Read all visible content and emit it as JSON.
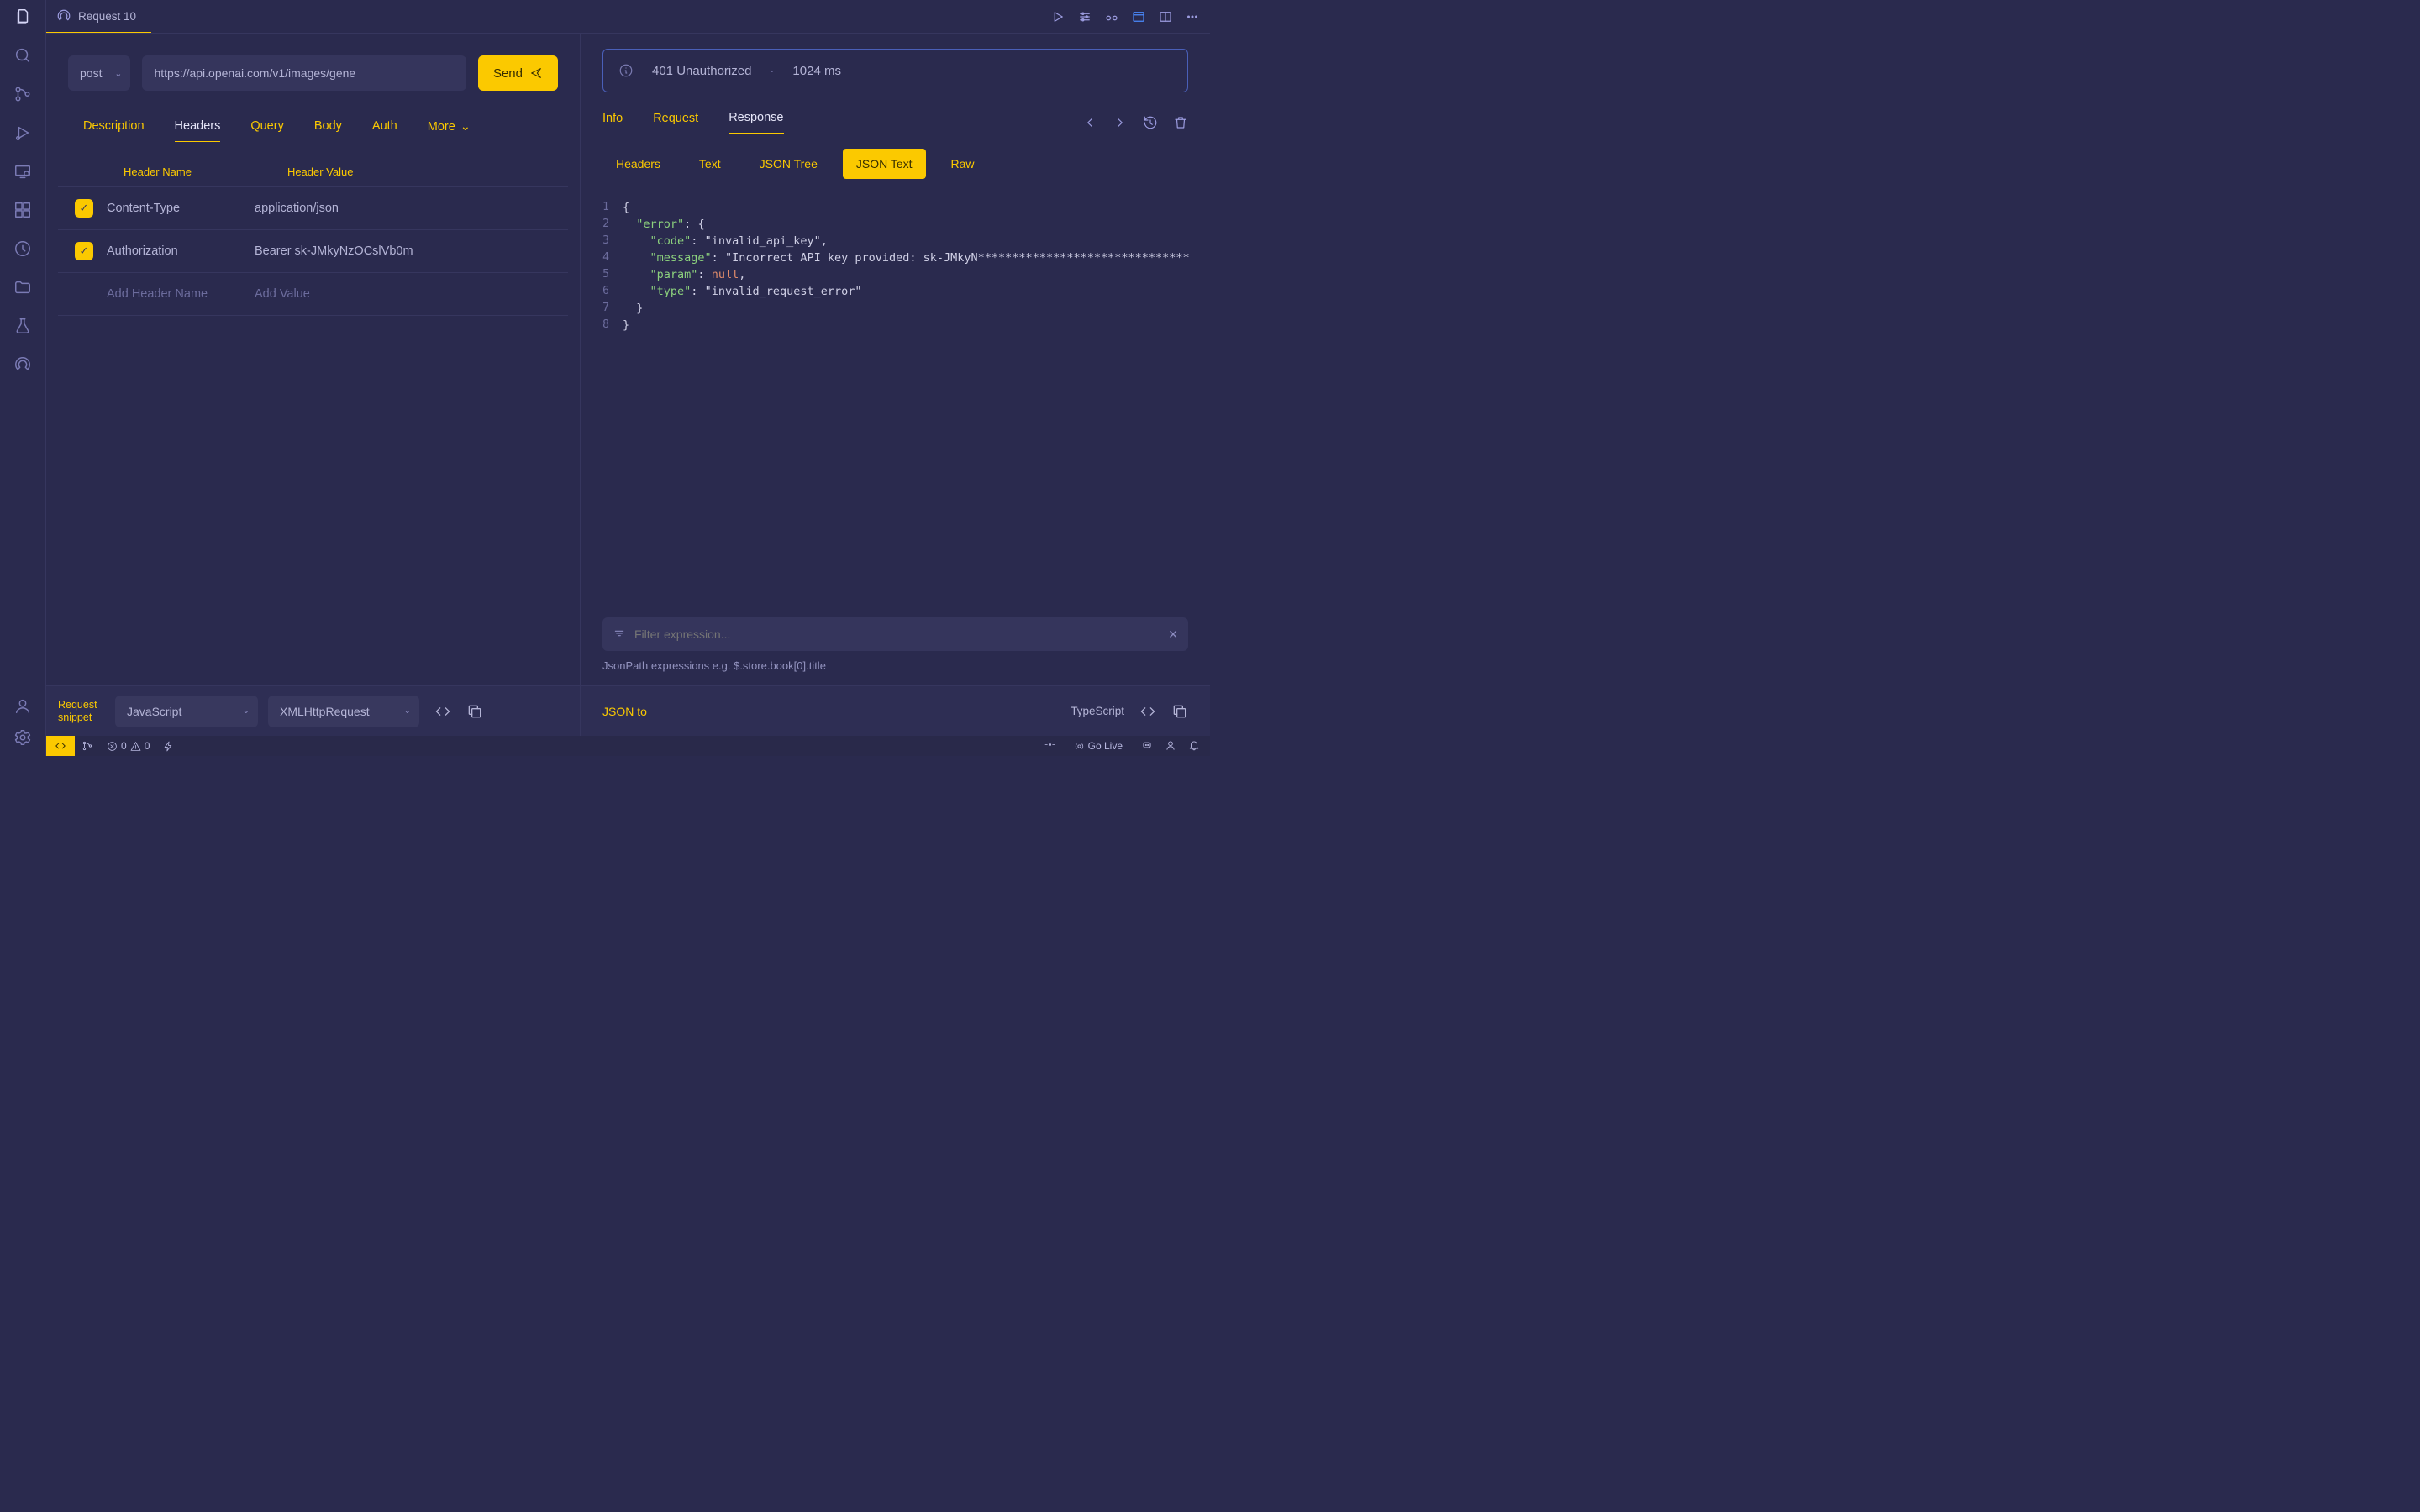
{
  "tab": {
    "title": "Request 10"
  },
  "request": {
    "method": "post",
    "url": "https://api.openai.com/v1/images/gene",
    "send_label": "Send",
    "tabs": [
      "Description",
      "Headers",
      "Query",
      "Body",
      "Auth",
      "More"
    ],
    "active_tab": "Headers",
    "header_table": {
      "col_name": "Header Name",
      "col_value": "Header Value",
      "rows": [
        {
          "enabled": true,
          "name": "Content-Type",
          "value": "application/json"
        },
        {
          "enabled": true,
          "name": "Authorization",
          "value": "Bearer sk-JMkyNzOCslVb0m"
        }
      ],
      "add_name_placeholder": "Add Header Name",
      "add_value_placeholder": "Add Value"
    },
    "snippet": {
      "label": "Request snippet",
      "lang": "JavaScript",
      "client": "XMLHttpRequest"
    }
  },
  "response": {
    "status_text": "401 Unauthorized",
    "time_text": "1024 ms",
    "tabs": [
      "Info",
      "Request",
      "Response"
    ],
    "active_tab": "Response",
    "view_tabs": [
      "Headers",
      "Text",
      "JSON Tree",
      "JSON Text",
      "Raw"
    ],
    "active_view": "JSON Text",
    "code_lines": [
      "{",
      "  \"error\": {",
      "    \"code\": \"invalid_api_key\",",
      "    \"message\": \"Incorrect API key provided: sk-JMkyN*******************************",
      "    \"param\": null,",
      "    \"type\": \"invalid_request_error\"",
      "  }",
      "}"
    ],
    "filter_placeholder": "Filter expression...",
    "jsonpath_hint": "JsonPath expressions e.g. $.store.book[0].title",
    "jsonto_label": "JSON to",
    "jsonto_lang": "TypeScript"
  },
  "statusbar": {
    "errors": "0",
    "warnings": "0",
    "golive": "Go Live"
  }
}
